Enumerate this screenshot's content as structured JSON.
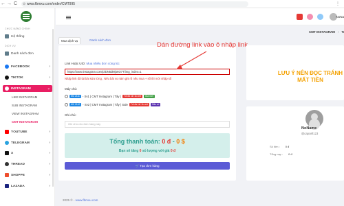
{
  "browser": {
    "url": "www.fbmxu.com/order/CMT995",
    "back": "←",
    "forward": "→",
    "reload": "C",
    "lock": "⊙",
    "menu": "⋮"
  },
  "sidebar": {
    "section_main": "CHỨC NĂNG CHÍNH",
    "item_system": "Hệ thống",
    "section_service": "DỊCH VỤ",
    "item_orders": "Danh sách đơn",
    "items": [
      {
        "label": "FACEBOOK",
        "color": "#1877f2"
      },
      {
        "label": "TIKTOK",
        "color": "#111111"
      },
      {
        "label": "INSTAGRAM",
        "color": "#e91e63"
      },
      {
        "label": "YOUTUBE",
        "color": "#ff0000"
      },
      {
        "label": "TELEGRAM",
        "color": "#2aa3df"
      },
      {
        "label": "X",
        "color": "#111111"
      },
      {
        "label": "THREAD",
        "color": "#333333"
      },
      {
        "label": "SHOPPE",
        "color": "#ee4d2d"
      },
      {
        "label": "LAZADA",
        "color": "#1a237e"
      }
    ],
    "instagram_subs": [
      "LIKE INSTAGRAM",
      "SUB INSTAGRAM",
      "VIEW INSTAGRAM",
      "CMT INSTAGRAM"
    ]
  },
  "topbar": {
    "user": "NoNa"
  },
  "breadcrumb": {
    "current": "CMT INSTAGRAM",
    "sep": "›",
    "tail": "Tr"
  },
  "tabs": {
    "buy": "Mua dịch vụ",
    "orders": "Danh sách đơn"
  },
  "form": {
    "link_label": "Link Hoặc UID:",
    "link_help": "Mua nhiều đơn cùng lúc",
    "link_value": "https://www.instagram.com/p/DN5dMjo6O7T/img_index=1",
    "link_hint": "Nhập link đã tải bài sửa từng , Nếu bài vo nám ghi rõ nếu mua + số thì mới nhập số",
    "server_label": "Máy chủ:",
    "servers": [
      {
        "code": "MC 2111",
        "text": "- Sv1 | CMT Instagram | Tây |",
        "tag1": "Tối đa 1k/ 1k cmt",
        "tag2": "Giá mới"
      },
      {
        "code": "MC 2112",
        "text": "- Sv2 | CMT Instagram | Tây | Sale",
        "tag1": "Tối đa 1k/ 1k cmt",
        "tag2": "Sẵn có"
      }
    ],
    "note_label": "Ghi chú:",
    "note_placeholder": "Ghi chú cho đơn hàng này",
    "total_prefix": "Tổng thanh toán:",
    "total_amount": "0 đ",
    "total_sep": " - ",
    "total_coin": "0 $",
    "save_prefix": "Bạn sẽ tăng",
    "save_zero": "0",
    "save_suffix": "số lượng với giá",
    "save_price": "0 đ",
    "submit": "Tạo đơn hàng",
    "submit_icon": "🛒"
  },
  "annotation": {
    "text": "Dán đường link vào ô nhập link",
    "color": "#e53935"
  },
  "notice": {
    "text": "LƯU Ý NÊN ĐỌC TRÁNH MẤT TIỀN"
  },
  "profile": {
    "name": "NoName",
    "handle": "@capcell123",
    "rows": [
      {
        "label": "Số tiền :",
        "value": "0 đ"
      },
      {
        "label": "Tổng nạp :",
        "value": "0 đ"
      }
    ]
  },
  "footer": {
    "prefix": "2025 ©",
    "link": "www.fbmxu.com"
  }
}
